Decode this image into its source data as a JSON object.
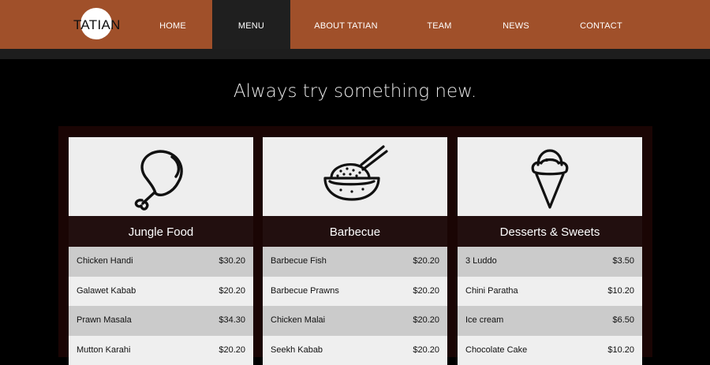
{
  "brand": {
    "name": "TATIAN"
  },
  "nav": {
    "items": [
      {
        "label": "HOME"
      },
      {
        "label": "MENU"
      },
      {
        "label": "ABOUT TATIAN"
      },
      {
        "label": "TEAM"
      },
      {
        "label": "NEWS"
      },
      {
        "label": "CONTACT"
      }
    ],
    "active": "MENU"
  },
  "hero": {
    "tagline": "Always try something new."
  },
  "menu": {
    "columns": [
      {
        "title": "Jungle Food",
        "icon": "chicken-leg-icon",
        "items": [
          {
            "name": "Chicken Handi",
            "price": "$30.20"
          },
          {
            "name": "Galawet Kabab",
            "price": "$20.20"
          },
          {
            "name": "Prawn Masala",
            "price": "$34.30"
          },
          {
            "name": "Mutton Karahi",
            "price": "$20.20"
          }
        ]
      },
      {
        "title": "Barbecue",
        "icon": "rice-bowl-chopsticks-icon",
        "items": [
          {
            "name": "Barbecue Fish",
            "price": "$20.20"
          },
          {
            "name": "Barbecue Prawns",
            "price": "$20.20"
          },
          {
            "name": "Chicken Malai",
            "price": "$20.20"
          },
          {
            "name": "Seekh Kabab",
            "price": "$20.20"
          }
        ]
      },
      {
        "title": "Desserts & Sweets",
        "icon": "ice-cream-cone-icon",
        "items": [
          {
            "name": "3 Luddo",
            "price": "$3.50"
          },
          {
            "name": "Chini Paratha",
            "price": "$10.20"
          },
          {
            "name": "Ice cream",
            "price": "$6.50"
          },
          {
            "name": "Chocolate Cake",
            "price": "$10.20"
          }
        ]
      }
    ]
  },
  "colors": {
    "nav_bg": "#a0502a",
    "active_nav_bg": "#1f1f1f",
    "card_header_bg": "#220f0f"
  }
}
